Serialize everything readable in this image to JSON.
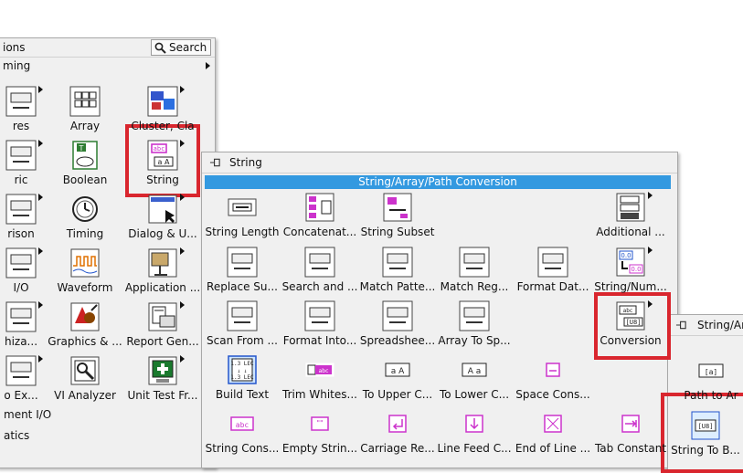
{
  "main_palette": {
    "header_partial": "ions",
    "search_label": "Search",
    "row1_partial": "ming",
    "items": [
      {
        "label": "res"
      },
      {
        "label": "Array"
      },
      {
        "label": "Cluster, Cla"
      },
      {
        "label": "ric"
      },
      {
        "label": "Boolean"
      },
      {
        "label": "String"
      },
      {
        "label": "rison"
      },
      {
        "label": "Timing"
      },
      {
        "label": "Dialog & U..."
      },
      {
        "label": "I/O"
      },
      {
        "label": "Waveform"
      },
      {
        "label": "Application ..."
      },
      {
        "label": "hiza..."
      },
      {
        "label": "Graphics & ..."
      },
      {
        "label": "Report Gen..."
      },
      {
        "label": "o Ex..."
      },
      {
        "label": "VI Analyzer"
      },
      {
        "label": "Unit Test Fr..."
      }
    ],
    "bottom_items": [
      "ment I/O",
      "atics"
    ]
  },
  "string_palette": {
    "title": "String",
    "header_bar": "String/Array/Path Conversion",
    "items": [
      {
        "label": "String Length"
      },
      {
        "label": "Concatenat..."
      },
      {
        "label": "String Subset"
      },
      {
        "label": "Additional ..."
      },
      {
        "label": "Replace Su..."
      },
      {
        "label": "Search and ..."
      },
      {
        "label": "Match Patte..."
      },
      {
        "label": "Match Reg..."
      },
      {
        "label": "Format Dat..."
      },
      {
        "label": "String/Num..."
      },
      {
        "label": "Scan From ..."
      },
      {
        "label": "Format Into..."
      },
      {
        "label": "Spreadshee..."
      },
      {
        "label": "Array To Sp..."
      },
      {
        "label": "Conversion"
      },
      {
        "label": "Build Text"
      },
      {
        "label": "Trim Whites..."
      },
      {
        "label": "To Upper C..."
      },
      {
        "label": "To Lower C..."
      },
      {
        "label": "Space Cons..."
      },
      {
        "label": "String Cons..."
      },
      {
        "label": "Empty Strin..."
      },
      {
        "label": "Carriage Re..."
      },
      {
        "label": "Line Feed C..."
      },
      {
        "label": "End of Line ..."
      },
      {
        "label": "Tab Constant"
      }
    ]
  },
  "conversion_palette": {
    "title": "String/Ar",
    "items": [
      {
        "label": "Path to Ar"
      },
      {
        "label": "String To B..."
      }
    ]
  },
  "colors": {
    "highlight": "#d9262e",
    "header_blue": "#3399e0",
    "string_pink": "#cc33cc"
  }
}
